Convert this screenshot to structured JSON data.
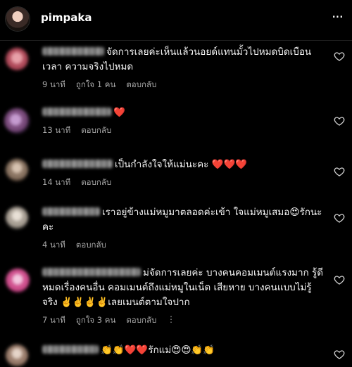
{
  "header": {
    "username": "pimpaka",
    "more_icon": "more-horizontal-icon",
    "more_glyph": "···"
  },
  "comments": [
    {
      "text": "จัดการเลยค่ะเห็นแล้วนอยด์แทนมั้วไปหมดบิดเบือนเวลา ความจริงไปหมด",
      "time": "9 นาที",
      "likes": "ถูกใจ 1 คน",
      "reply": "ตอบกลับ"
    },
    {
      "text": "❤️",
      "time": "13 นาที",
      "reply": "ตอบกลับ"
    },
    {
      "text": "เป็นกำลังใจให้แม่นะคะ ❤️❤️❤️",
      "time": "14 นาที",
      "reply": "ตอบกลับ"
    },
    {
      "text": "เราอยู่ข้างแม่หมูมาตลอดค่ะเข้า ใจแม่หมูเสมอ😍รักนะคะ",
      "time": "4 นาที",
      "reply": "ตอบกลับ"
    },
    {
      "text": "ม่จัดการเลยค่ะ บางคนคอมเมนต์แรงมาก รู้ดีหมดเรื่องคนอื่น คอมเมนต์ถึงแม่หมูในเน็ต เสียหาย บางคนแบบไม่รู้จริง ✌️✌️✌️✌️เลยเมนต์ตามใจปาก",
      "time": "7 นาที",
      "likes": "ถูกใจ 3 คน",
      "reply": "ตอบกลับ",
      "translate_glyph": "⋮"
    },
    {
      "text": "👏👏❤️❤️รักแม่😍😍👏👏"
    }
  ],
  "icons": {
    "like": "heart-outline-icon"
  }
}
